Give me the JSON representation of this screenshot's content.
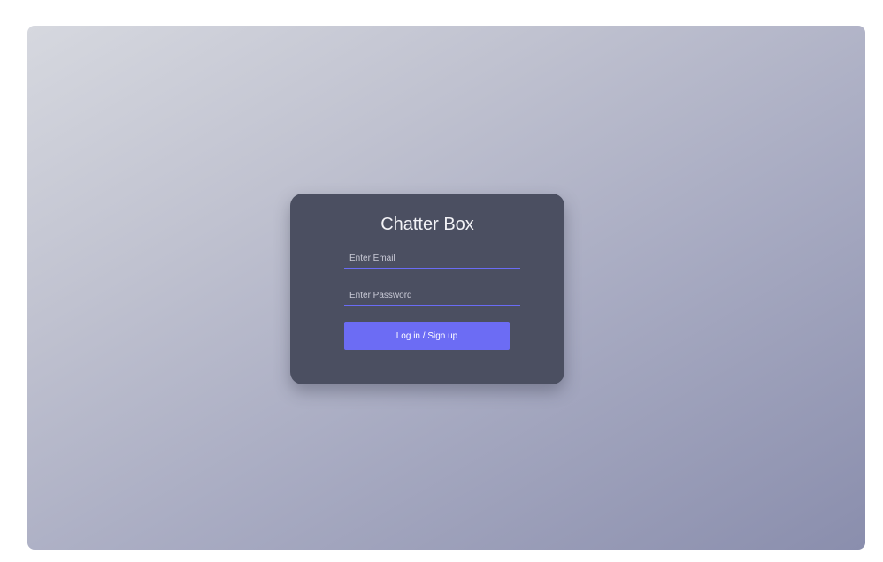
{
  "login": {
    "title": "Chatter Box",
    "email": {
      "placeholder": "Enter Email",
      "value": ""
    },
    "password": {
      "placeholder": "Enter Password",
      "value": ""
    },
    "submit_label": "Log in / Sign up"
  },
  "colors": {
    "card_background": "#4b4f61",
    "accent": "#6c6cf4",
    "title_text": "#f2f2f6"
  }
}
